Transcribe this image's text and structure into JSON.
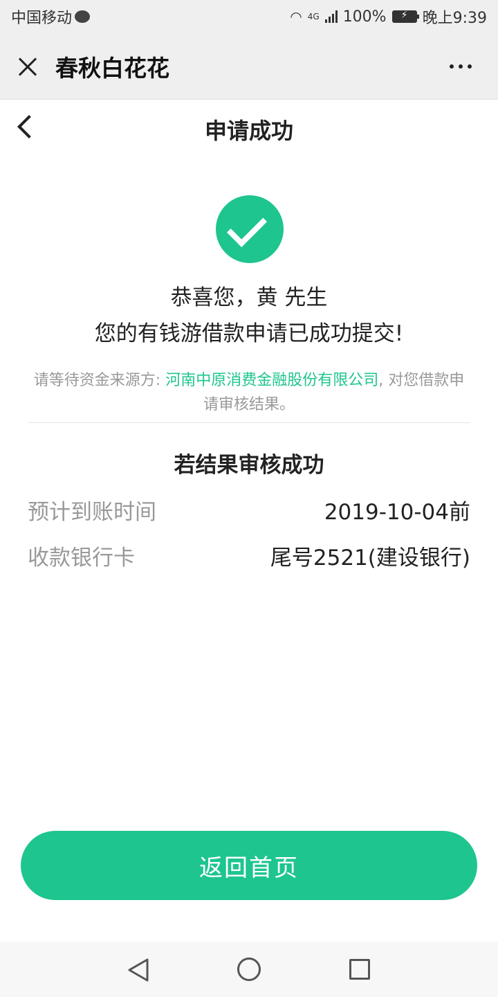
{
  "status_bar": {
    "carrier": "中国移动",
    "network": "4G",
    "battery": "100%",
    "time": "晚上9:39",
    "icons": [
      "chat-bubble-icon",
      "wifi-icon",
      "signal-icon",
      "battery-icon"
    ]
  },
  "title_bar": {
    "title": "春秋白花花",
    "icons": [
      "close-icon",
      "more-icon"
    ]
  },
  "page": {
    "title": "申请成功",
    "icons": [
      "back-icon",
      "success-check-icon"
    ]
  },
  "success": {
    "greeting": "恭喜您，黄 先生",
    "message": "您的有钱游借款申请已成功提交!"
  },
  "notice": {
    "prefix": "请等待资金来源方: ",
    "company": "河南中原消费金融股份有限公司",
    "suffix": ", 对您借款申请审核结果。"
  },
  "result": {
    "title": "若结果审核成功",
    "rows": [
      {
        "label": "预计到账时间",
        "value": "2019-10-04前"
      },
      {
        "label": "收款银行卡",
        "value": "尾号2521(建设银行)"
      }
    ]
  },
  "actions": {
    "home_button": "返回首页"
  },
  "colors": {
    "accent": "#1ec58f",
    "muted_text": "#999999",
    "bar_bg": "#efefef"
  },
  "nav_bar": {
    "icons": [
      "nav-back-icon",
      "nav-home-icon",
      "nav-recent-icon"
    ]
  }
}
